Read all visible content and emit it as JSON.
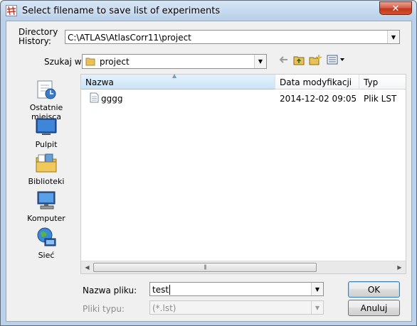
{
  "window": {
    "title": "Select filename to save list of experiments",
    "close_glyph": "✕"
  },
  "directory_history": {
    "label_line1": "Directory",
    "label_line2": "History:",
    "value": "C:\\ATLAS\\AtlasCorr11\\project"
  },
  "look_in": {
    "label": "Szukaj w:",
    "value": "project"
  },
  "toolbar": {
    "icons": [
      "back-arrow-icon",
      "up-folder-icon",
      "new-folder-icon",
      "view-menu-icon"
    ]
  },
  "places": [
    {
      "label": "Ostatnie miejsca",
      "icon": "recent-places-icon"
    },
    {
      "label": "Pulpit",
      "icon": "desktop-icon"
    },
    {
      "label": "Biblioteki",
      "icon": "libraries-icon"
    },
    {
      "label": "Komputer",
      "icon": "computer-icon"
    },
    {
      "label": "Sieć",
      "icon": "network-icon"
    }
  ],
  "file_list": {
    "columns": [
      "Nazwa",
      "Data modyfikacji",
      "Typ"
    ],
    "rows": [
      {
        "name": "gggg",
        "modified": "2014-12-02 09:05",
        "type": "Plik LST"
      }
    ]
  },
  "filename": {
    "label": "Nazwa pliku:",
    "value": "test"
  },
  "filetype": {
    "label": "Pliki typu:",
    "value": "(*.lst)"
  },
  "buttons": {
    "ok": "OK",
    "cancel": "Anuluj"
  }
}
